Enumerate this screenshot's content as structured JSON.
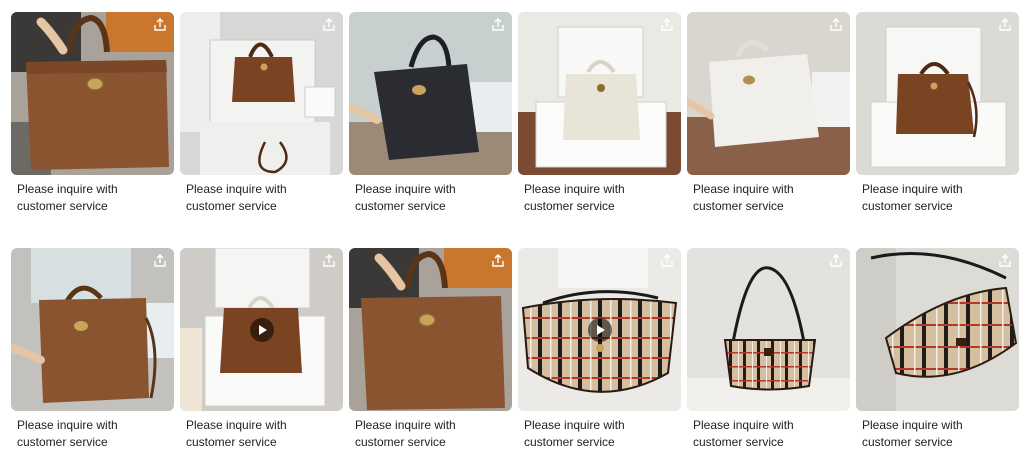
{
  "caption": "Please inquire with customer service",
  "share_icon": "share-icon",
  "play_icon": "play-icon",
  "products": [
    {
      "bag": "tan tote, handheld",
      "has_video": false
    },
    {
      "bag": "brown tote in box",
      "has_video": false
    },
    {
      "bag": "black tote, handheld",
      "has_video": false
    },
    {
      "bag": "ivory tote in box",
      "has_video": false
    },
    {
      "bag": "white tote, handheld",
      "has_video": false
    },
    {
      "bag": "brown tote in box",
      "has_video": false
    },
    {
      "bag": "tan tote, handheld",
      "has_video": false
    },
    {
      "bag": "brown tote in box",
      "has_video": true
    },
    {
      "bag": "tan tote, handheld",
      "has_video": false
    },
    {
      "bag": "check shoulder bag",
      "has_video": true
    },
    {
      "bag": "check shoulder bag",
      "has_video": false
    },
    {
      "bag": "check shoulder bag",
      "has_video": false
    }
  ],
  "colors": {
    "tan": "#8a5430",
    "brown": "#7a4322",
    "black": "#2a2c31",
    "ivory": "#e9e4d8",
    "white": "#f0efeb",
    "check_base": "#d4bfa0",
    "check_red": "#b5372c",
    "check_black": "#1f1d1c"
  }
}
